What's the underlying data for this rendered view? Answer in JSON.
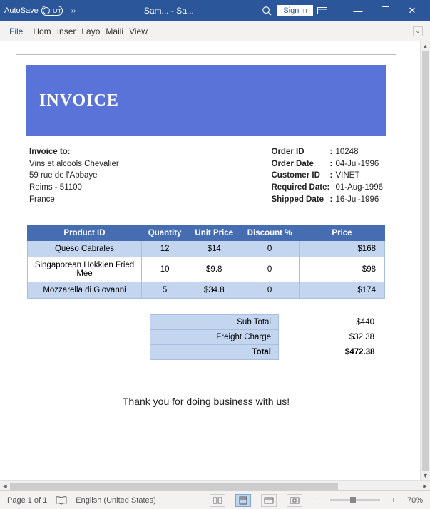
{
  "titlebar": {
    "autosave_label": "AutoSave",
    "autosave_state": "Off",
    "chevrons": "››",
    "doc_title": "Sam...  - Sa...",
    "signin": "Sign in"
  },
  "ribbon": {
    "file": "File",
    "tabs": [
      "Hom",
      "Inser",
      "Layo",
      "Maili",
      "View"
    ]
  },
  "invoice": {
    "heading": "INVOICE",
    "to_label": "Invoice to:",
    "to_lines": [
      "Vins et alcools Chevalier",
      "59 rue de l'Abbaye",
      "Reims - 51100",
      "France"
    ],
    "meta": [
      {
        "label": "Order ID",
        "value": "10248"
      },
      {
        "label": "Order Date",
        "value": "04-Jul-1996"
      },
      {
        "label": "Customer ID",
        "value": "VINET"
      },
      {
        "label": "Required Date:",
        "value": "01-Aug-1996",
        "nocolon": true
      },
      {
        "label": "Shipped Date",
        "value": "16-Jul-1996"
      }
    ],
    "columns": [
      "Product ID",
      "Quantity",
      "Unit Price",
      "Discount %",
      "Price"
    ],
    "rows": [
      {
        "pid": "Queso Cabrales",
        "qty": "12",
        "unit": "$14",
        "disc": "0",
        "price": "$168"
      },
      {
        "pid": "Singaporean Hokkien Fried Mee",
        "qty": "10",
        "unit": "$9.8",
        "disc": "0",
        "price": "$98"
      },
      {
        "pid": "Mozzarella di Giovanni",
        "qty": "5",
        "unit": "$34.8",
        "disc": "0",
        "price": "$174"
      }
    ],
    "totals": [
      {
        "label": "Sub Total",
        "value": "$440"
      },
      {
        "label": "Freight Charge",
        "value": "$32.38"
      },
      {
        "label": "Total",
        "value": "$472.38"
      }
    ],
    "thanks": "Thank you for doing business with us!"
  },
  "status": {
    "page": "Page 1 of 1",
    "lang": "English (United States)",
    "zoom": "70%"
  }
}
